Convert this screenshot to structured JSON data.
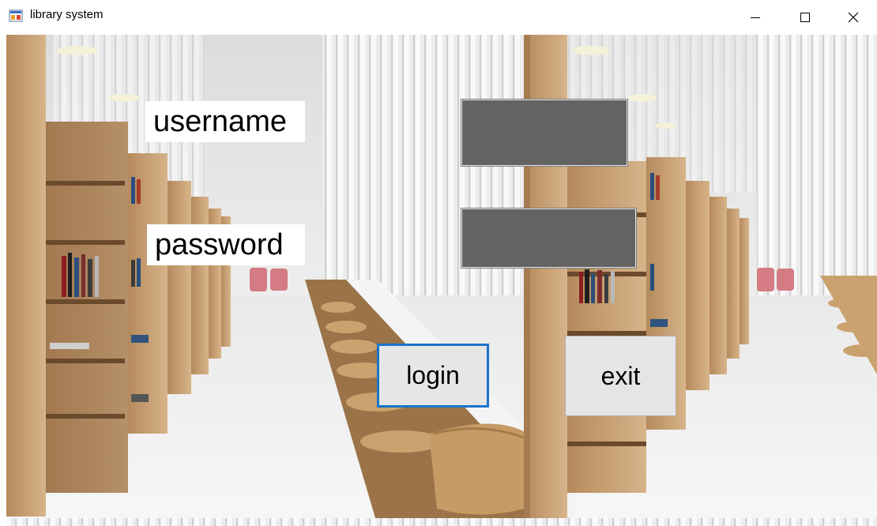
{
  "window": {
    "title": "library system",
    "icon": "winforms-app-icon",
    "controls": [
      "minimize-icon",
      "maximize-icon",
      "close-icon"
    ]
  },
  "form": {
    "username_label": "username",
    "password_label": "password",
    "username_value": "",
    "password_value": "",
    "login_label": "login",
    "exit_label": "exit"
  },
  "colors": {
    "field_background": "#636363",
    "focus_border": "#1a74c9",
    "button_face": "#e5e5e5"
  }
}
